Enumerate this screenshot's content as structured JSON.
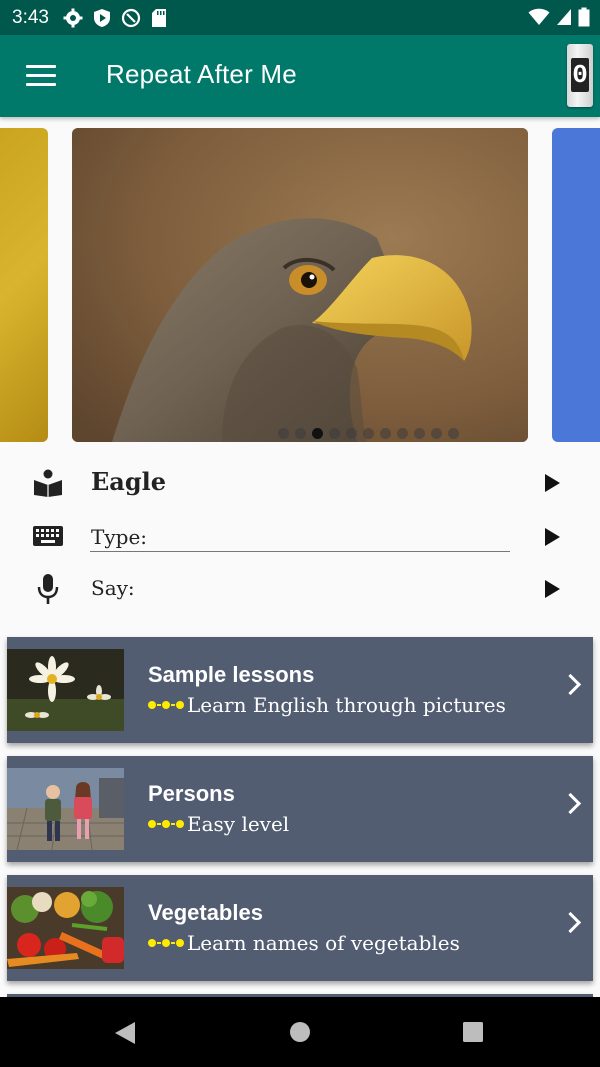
{
  "status_bar": {
    "time": "3:43"
  },
  "app_bar": {
    "title": "Repeat After Me",
    "counter": "0"
  },
  "carousel": {
    "main_slide": "eagle-photo",
    "dot_count": 11,
    "active_dot": 2
  },
  "word": {
    "label": "Eagle"
  },
  "type_row": {
    "label": "Type:"
  },
  "say_row": {
    "label": "Say:"
  },
  "lessons": [
    {
      "title": "Sample lessons",
      "subtitle": "Learn English through pictures",
      "thumb": "daisies-photo"
    },
    {
      "title": "Persons",
      "subtitle": "Easy level",
      "thumb": "children-photo"
    },
    {
      "title": "Vegetables",
      "subtitle": "Learn names of vegetables",
      "thumb": "vegetables-photo"
    }
  ],
  "colors": {
    "status_bar": "#00574b",
    "app_bar": "#00796b",
    "card": "#535d72",
    "level_dots": "#ffeb00"
  }
}
